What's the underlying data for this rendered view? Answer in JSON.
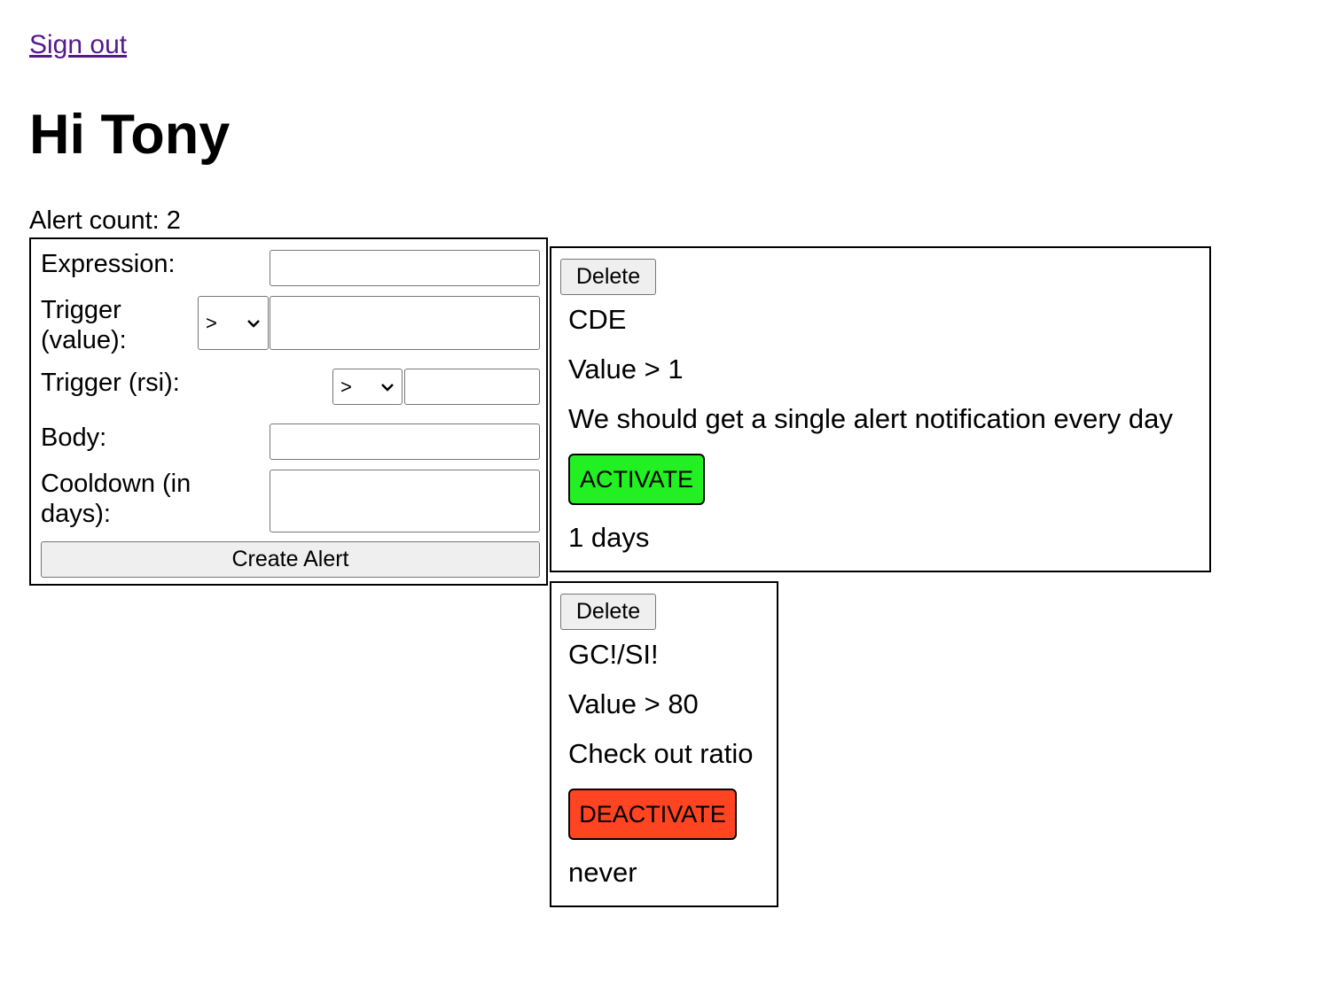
{
  "header": {
    "signout_label": "Sign out",
    "greeting": "Hi Tony",
    "alert_count_label": "Alert count: 2"
  },
  "form": {
    "expression_label": "Expression:",
    "expression_value": "",
    "trigger_value_label_line1": "Trigger",
    "trigger_value_label_line2": "(value):",
    "trigger_value_operator": ">",
    "trigger_value_value": "",
    "trigger_rsi_label": "Trigger (rsi):",
    "trigger_rsi_operator": ">",
    "trigger_rsi_value": "",
    "body_label": "Body:",
    "body_value": "",
    "cooldown_label_line1": "Cooldown (in",
    "cooldown_label_line2": "days):",
    "cooldown_value": "",
    "create_button_label": "Create Alert"
  },
  "alerts": [
    {
      "delete_label": "Delete",
      "expression": "CDE",
      "condition": "Value > 1",
      "body": "We should get a single alert notification every day",
      "state_button_label": "ACTIVATE",
      "state_button_color": "#22f022",
      "cooldown": "1 days"
    },
    {
      "delete_label": "Delete",
      "expression": "GC!/SI!",
      "condition": "Value > 80",
      "body": "Check out ratio",
      "state_button_label": "DEACTIVATE",
      "state_button_color": "#ff4422",
      "cooldown": "never"
    }
  ],
  "colors": {
    "link": "#551a8b",
    "activate": "#22f022",
    "deactivate": "#ff4422"
  },
  "icons": {
    "select_arrow": "chevron-down-icon"
  }
}
